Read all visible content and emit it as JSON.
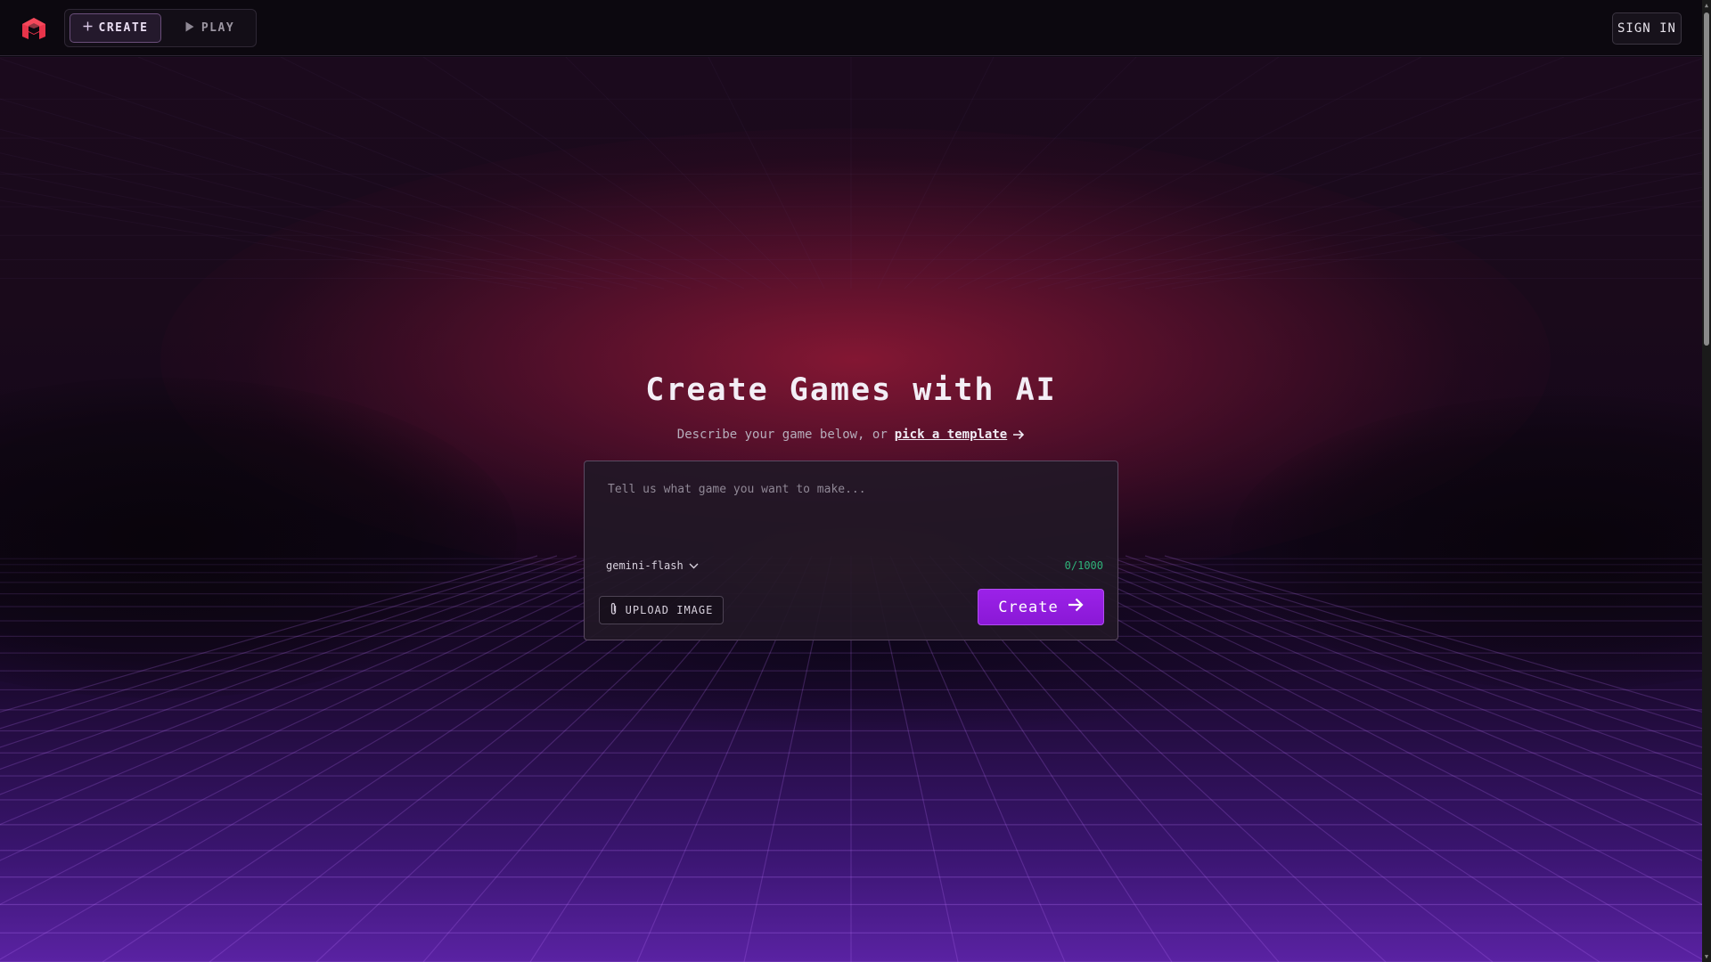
{
  "topbar": {
    "create_label": "CREATE",
    "play_label": "PLAY",
    "signin_label": "SIGN IN"
  },
  "hero": {
    "title": "Create Games with AI",
    "subtitle_prefix": "Describe your game below, or",
    "template_link": "pick a template"
  },
  "prompt_card": {
    "placeholder": "Tell us what game you want to make...",
    "value": "",
    "model": "gemini-flash",
    "counter": "0/1000",
    "upload_label": "UPLOAD IMAGE",
    "create_label": "Create"
  },
  "colors": {
    "accent": "#9b22e8",
    "logo": "#e8344a",
    "counter": "#2fb37a",
    "background": "#0d0711"
  },
  "icons": [
    "logo-icon",
    "plus-icon",
    "play-icon",
    "arrow-right-icon",
    "chevron-down-icon",
    "paperclip-icon"
  ]
}
